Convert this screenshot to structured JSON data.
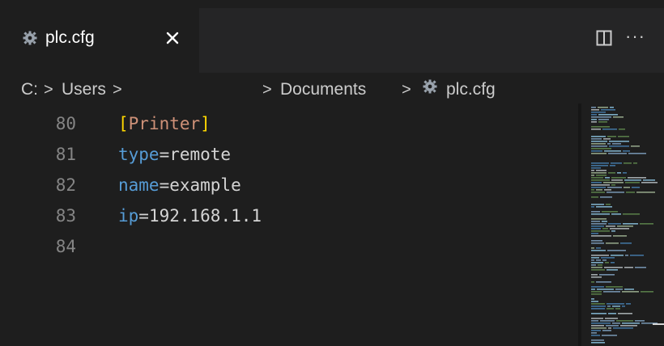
{
  "tab": {
    "title": "plc.cfg",
    "close_icon": "close-icon",
    "file_icon": "gear-icon"
  },
  "toolbar": {
    "split_icon": "split-editor-icon",
    "more_label": "···"
  },
  "breadcrumb": {
    "items": [
      "C:",
      "Users",
      "Documents",
      "plc.cfg"
    ],
    "separator": ">"
  },
  "editor": {
    "lines": [
      {
        "number": "80",
        "parts": [
          [
            "br",
            "["
          ],
          [
            "section",
            "Printer"
          ],
          [
            "br",
            "]"
          ]
        ]
      },
      {
        "number": "81",
        "parts": [
          [
            "kw",
            "type"
          ],
          [
            "tx",
            "=remote"
          ]
        ]
      },
      {
        "number": "82",
        "parts": [
          [
            "kw",
            "name"
          ],
          [
            "tx",
            "=example"
          ]
        ]
      },
      {
        "number": "83",
        "parts": [
          [
            "kw",
            "ip"
          ],
          [
            "tx",
            "=192.168.1.1"
          ]
        ]
      },
      {
        "number": "84",
        "parts": []
      }
    ]
  },
  "colors": {
    "background": "#1e1e1e",
    "tabbar": "#252526",
    "keyword": "#569cd6",
    "text": "#d4d4d4",
    "bracket": "#ffd700",
    "section": "#ce9178",
    "line_number": "#858585"
  }
}
